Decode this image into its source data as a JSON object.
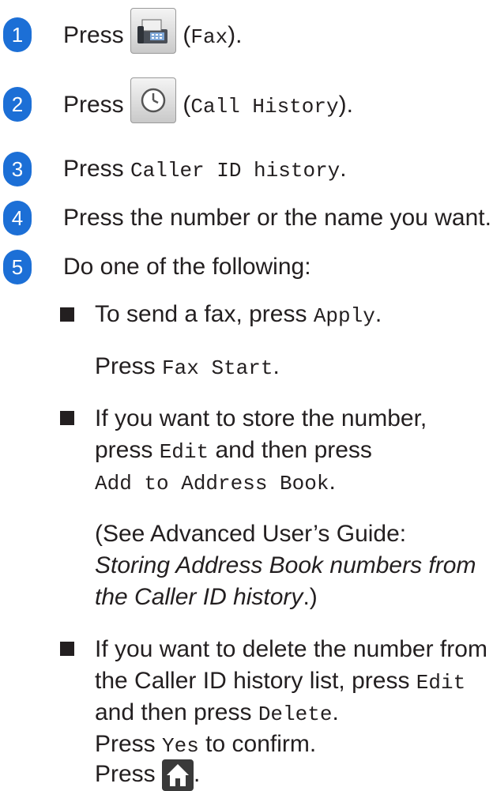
{
  "steps": [
    {
      "num": "1",
      "pre": "Press ",
      "code": "Fax",
      "open": " (",
      "close": ")."
    },
    {
      "num": "2",
      "pre": "Press ",
      "code": "Call History",
      "open": " (",
      "close": ")."
    },
    {
      "num": "3",
      "pre": "Press ",
      "code": "Caller ID history",
      "close": "."
    },
    {
      "num": "4",
      "text": "Press the number or the name you want."
    },
    {
      "num": "5",
      "text": "Do one of the following:"
    }
  ],
  "option1": {
    "pre": "To send a fax, press ",
    "code": "Apply",
    "post": ".",
    "line2_pre": "Press ",
    "line2_code": "Fax Start",
    "line2_post": "."
  },
  "option2": {
    "line1": "If you want to store the number,",
    "line2_pre": "press ",
    "line2_code": "Edit",
    "line2_post": " and then press",
    "line3_code": "Add to Address Book",
    "line3_post": ".",
    "ref_line1": "(See Advanced User’s Guide:",
    "ref_italic1": "Storing Address Book numbers from",
    "ref_italic2": "the Caller ID history",
    "ref_end": ".)"
  },
  "option3": {
    "line1": "If you want to delete the number from",
    "line2_pre": "the Caller ID history list, press ",
    "line2_code": "Edit",
    "line3_pre": "and then press ",
    "line3_code": "Delete",
    "line3_post": ".",
    "confirm_pre": "Press ",
    "confirm_code": "Yes",
    "confirm_post": " to confirm.",
    "home_pre": "Press ",
    "home_post": "."
  },
  "colors": {
    "step_badge": "#1c6fd6",
    "text": "#231f20"
  },
  "icons": [
    "fax-icon",
    "clock-icon",
    "home-icon"
  ]
}
